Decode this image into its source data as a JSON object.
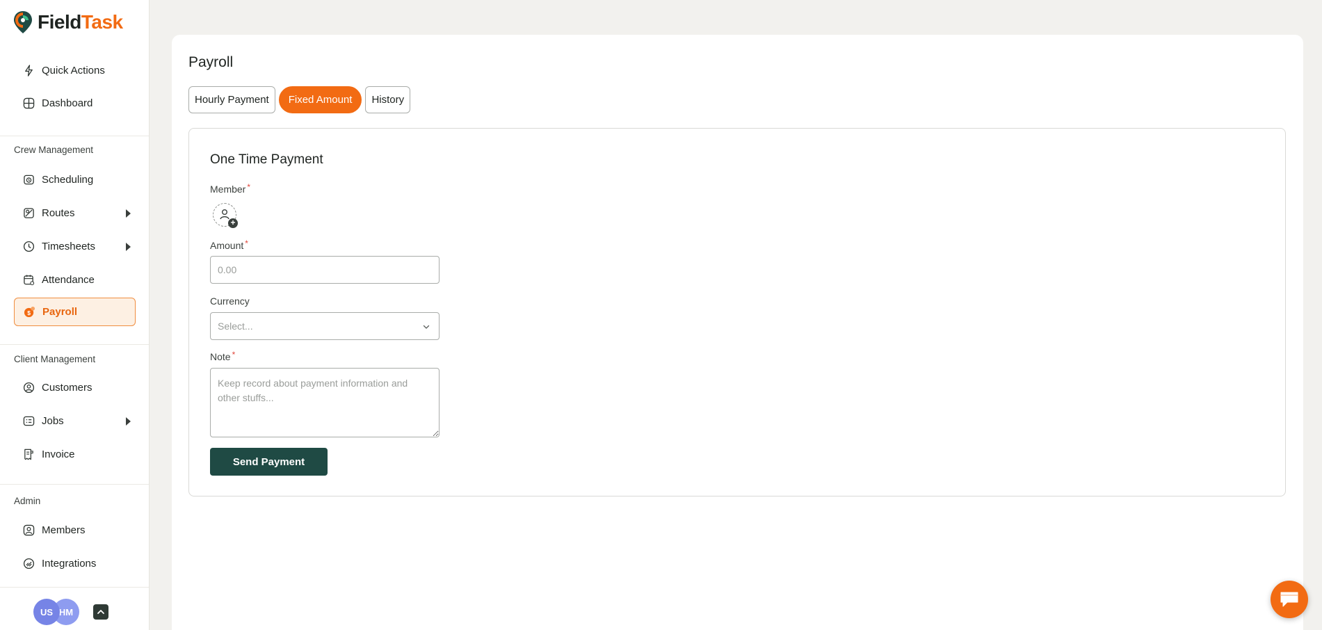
{
  "app": {
    "brand_part1": "Field",
    "brand_part2": "Task",
    "brand_color": "#f26b13"
  },
  "sidebar": {
    "top_items": [
      {
        "label": "Quick Actions",
        "icon": "bolt-icon"
      },
      {
        "label": "Dashboard",
        "icon": "dashboard-grid-icon"
      }
    ],
    "crew_label": "Crew Management",
    "crew_items": [
      {
        "label": "Scheduling",
        "icon": "calendar-clock-icon"
      },
      {
        "label": "Routes",
        "icon": "map-route-icon",
        "expandable": true
      },
      {
        "label": "Timesheets",
        "icon": "clock-icon",
        "expandable": true
      },
      {
        "label": "Attendance",
        "icon": "calendar-check-icon"
      },
      {
        "label": "Payroll",
        "icon": "payroll-coin-icon",
        "active": true
      }
    ],
    "client_label": "Client Management",
    "client_items": [
      {
        "label": "Customers",
        "icon": "customers-icon"
      },
      {
        "label": "Jobs",
        "icon": "jobs-list-icon",
        "expandable": true
      },
      {
        "label": "Invoice",
        "icon": "invoice-icon"
      }
    ],
    "admin_label": "Admin",
    "admin_items": [
      {
        "label": "Members",
        "icon": "members-icon"
      },
      {
        "label": "Integrations",
        "icon": "integrations-icon"
      }
    ],
    "footer": {
      "avatar1": "US",
      "avatar2": "HM"
    }
  },
  "main": {
    "title": "Payroll",
    "tabs": [
      {
        "label": "Hourly Payment"
      },
      {
        "label": "Fixed Amount",
        "active": true
      },
      {
        "label": "History"
      }
    ],
    "form": {
      "title": "One Time Payment",
      "member_label": "Member",
      "amount_label": "Amount",
      "amount_placeholder": "0.00",
      "currency_label": "Currency",
      "currency_placeholder": "Select...",
      "note_label": "Note",
      "note_placeholder": "Keep record about payment information and other stuffs...",
      "required_mark": "*",
      "submit_label": "Send Payment"
    }
  },
  "colors": {
    "accent": "#f26b13",
    "primary_button": "#1f4a44",
    "active_nav_bg": "#fdf0e3"
  }
}
